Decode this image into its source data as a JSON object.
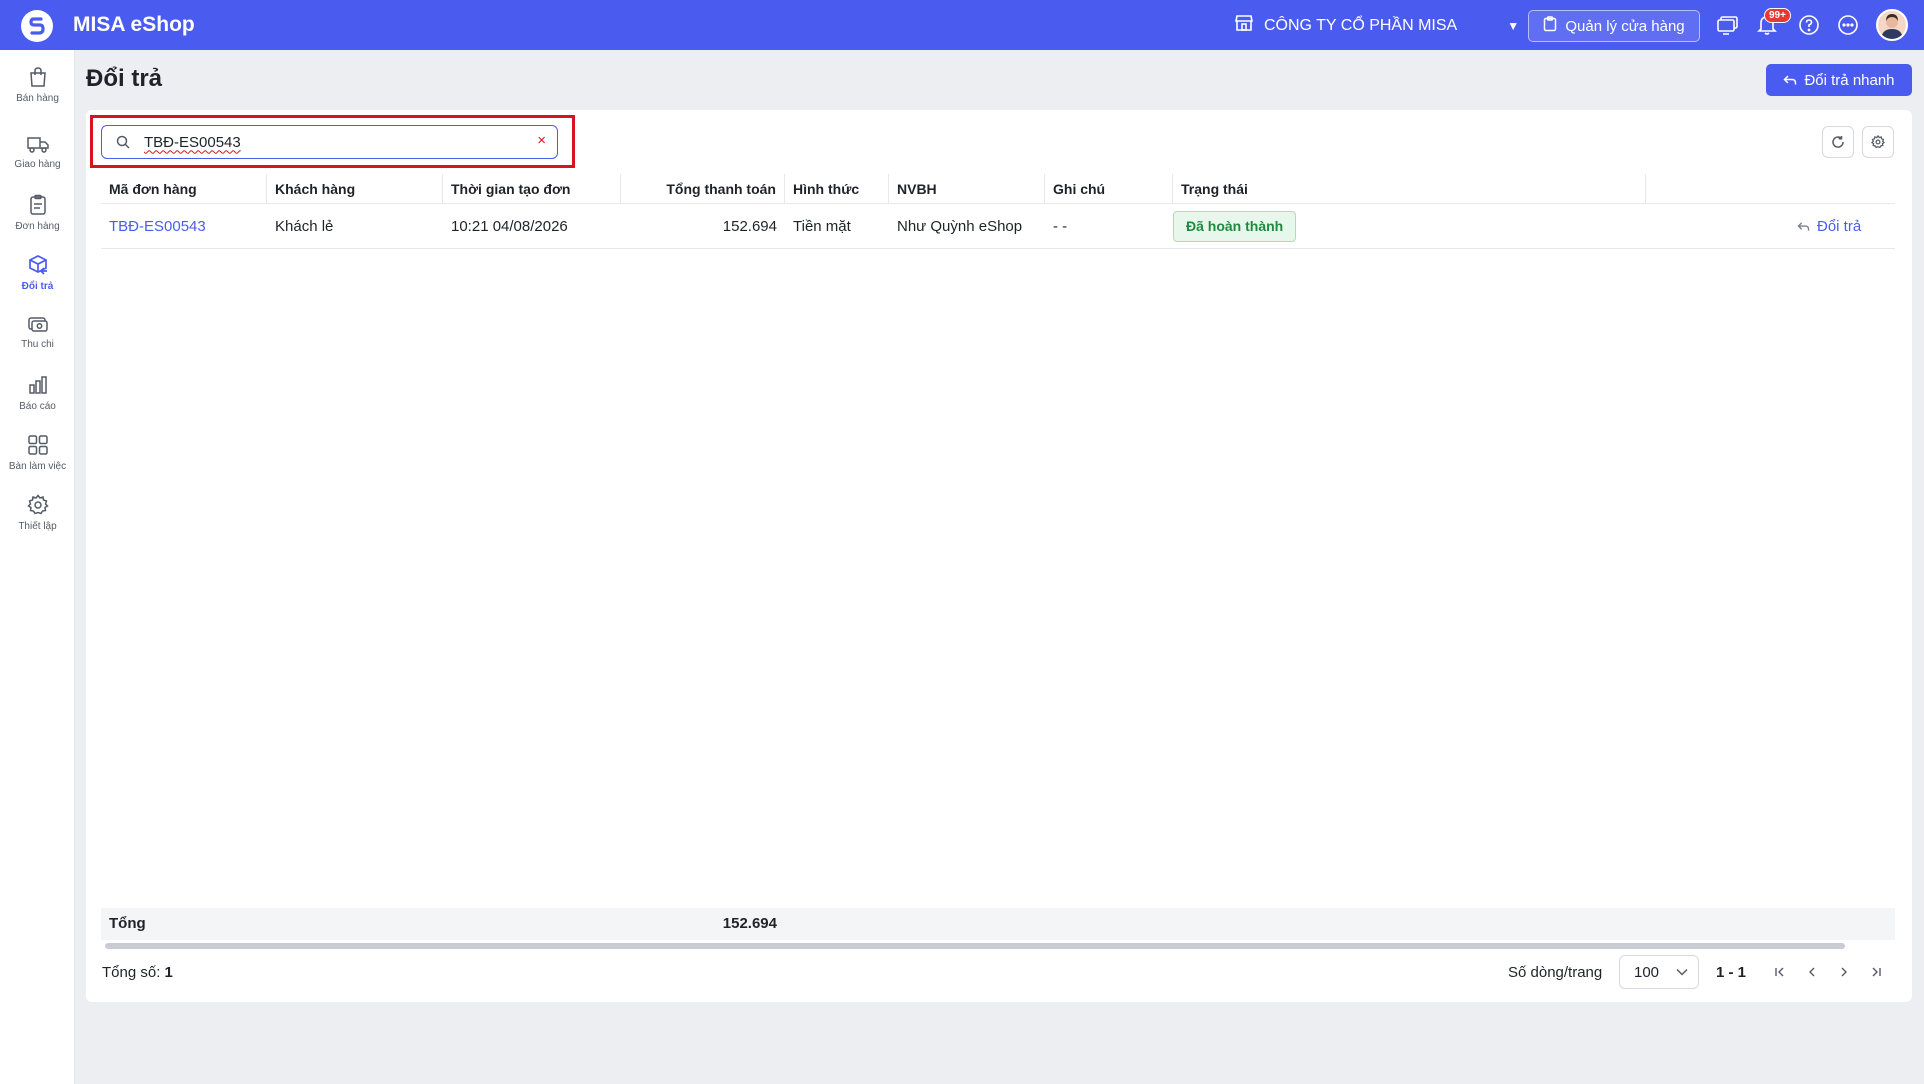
{
  "topbar": {
    "app_title": "MISA eShop",
    "company_name": "CÔNG TY CỔ PHẦN MISA",
    "store_button": "Quản lý cửa hàng",
    "notification_badge": "99+",
    "bg_color": "#4a5cf0"
  },
  "sidebar": {
    "items": [
      {
        "label": "Bán hàng",
        "icon": "shopping-bag-icon"
      },
      {
        "label": "Giao hàng",
        "icon": "delivery-truck-icon"
      },
      {
        "label": "Đơn hàng",
        "icon": "clipboard-icon"
      },
      {
        "label": "Đổi trả",
        "icon": "return-box-icon",
        "active": true
      },
      {
        "label": "Thu chi",
        "icon": "cash-icon"
      },
      {
        "label": "Báo cáo",
        "icon": "bar-chart-icon"
      },
      {
        "label": "Bàn làm việc",
        "icon": "grid-icon"
      },
      {
        "label": "Thiết lập",
        "icon": "gear-icon"
      }
    ]
  },
  "page": {
    "title": "Đổi trả",
    "quick_button": "Đổi trả nhanh"
  },
  "search": {
    "value": "TBĐ-ES00543",
    "clear_symbol": "×"
  },
  "table": {
    "headers": [
      "Mã đơn hàng",
      "Khách hàng",
      "Thời gian tạo đơn",
      "Tổng thanh toán",
      "Hình thức",
      "NVBH",
      "Ghi chú",
      "Trạng thái"
    ],
    "rows": [
      {
        "order_code": "TBĐ-ES00543",
        "customer": "Khách lẻ",
        "created_time": "10:21 04/08/2026",
        "total": "152.694",
        "payment": "Tiền mặt",
        "staff": "Như Quỳnh eShop",
        "note": "- -",
        "status": "Đã hoàn thành",
        "action": "Đổi trả"
      }
    ],
    "footer": {
      "label": "Tổng",
      "total": "152.694"
    }
  },
  "pagination": {
    "total_label": "Tổng số:",
    "total_value": "1",
    "rows_label": "Số dòng/trang",
    "rows_per_page": "100",
    "range": "1 - 1"
  }
}
